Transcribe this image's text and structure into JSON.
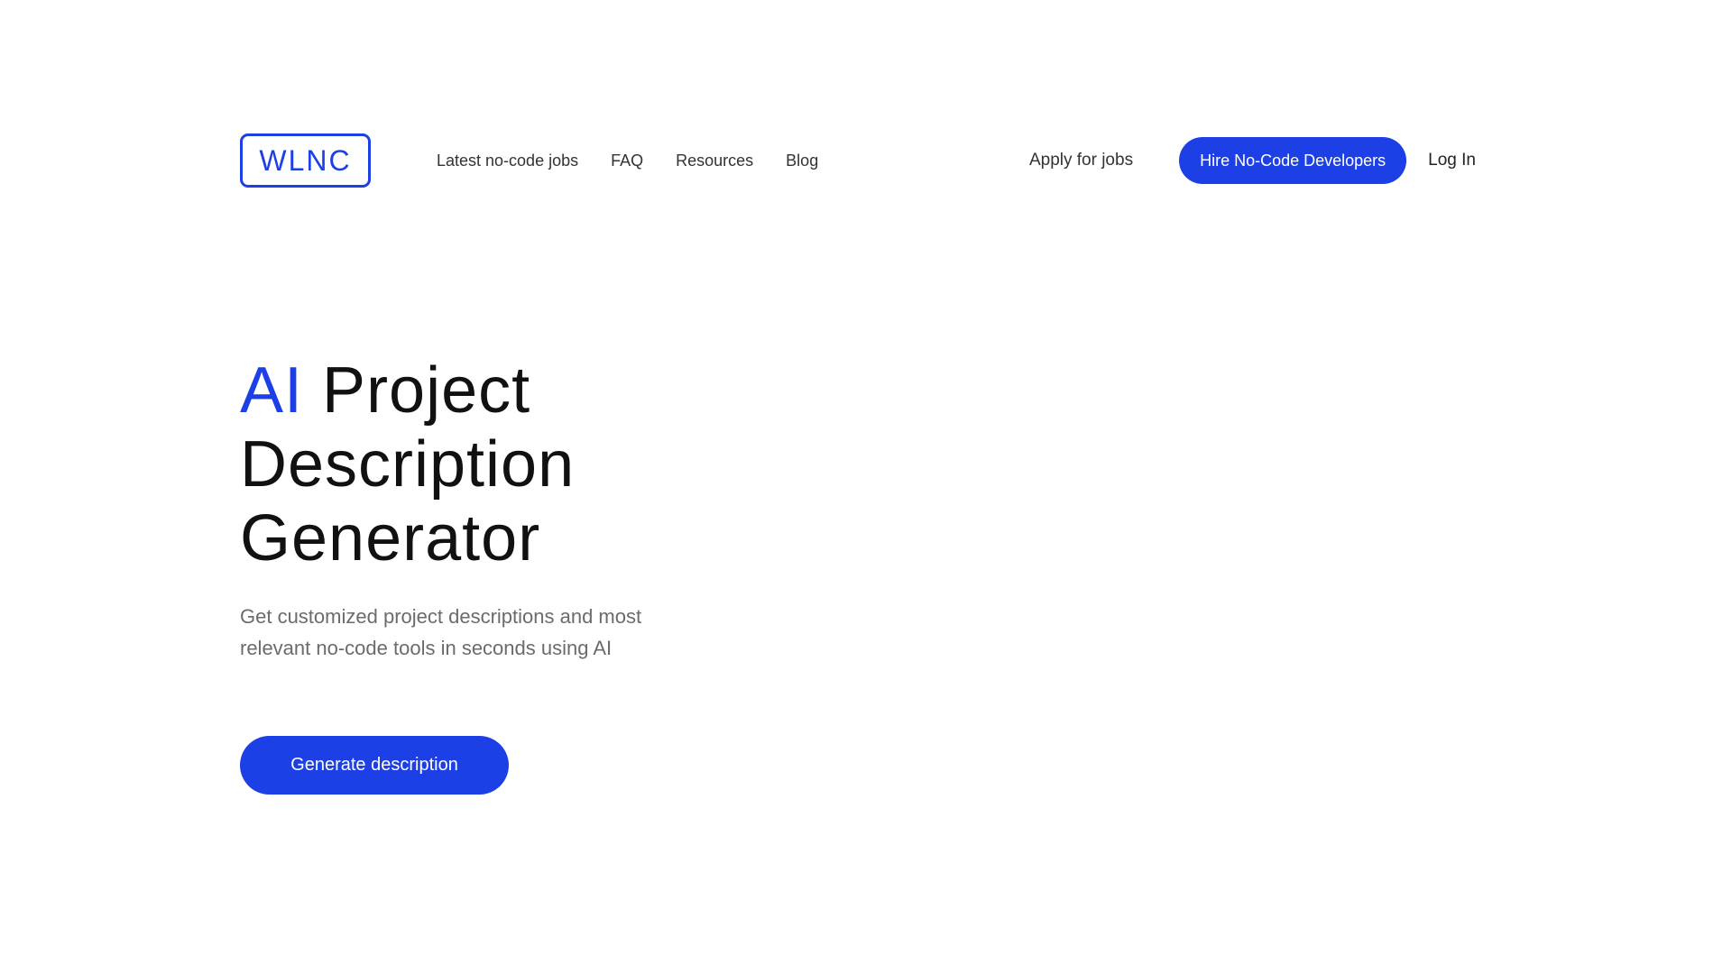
{
  "header": {
    "logo_text": "WLNC",
    "nav_links": [
      "Latest no-code jobs",
      "FAQ",
      "Resources",
      "Blog"
    ],
    "apply_label": "Apply for jobs",
    "hire_label": "Hire No-Code Developers",
    "login_label": "Log In"
  },
  "hero": {
    "title_accent": "AI",
    "title_rest_line1": "Project",
    "title_line2": "Description",
    "title_line3": "Generator",
    "subtitle_line1": "Get customized project descriptions and most",
    "subtitle_line2": "relevant no-code tools in seconds using AI",
    "cta_label": "Generate description"
  },
  "colors": {
    "accent": "#1d3fe6",
    "text_dark": "#111111",
    "text_muted": "#6b6b6b"
  }
}
